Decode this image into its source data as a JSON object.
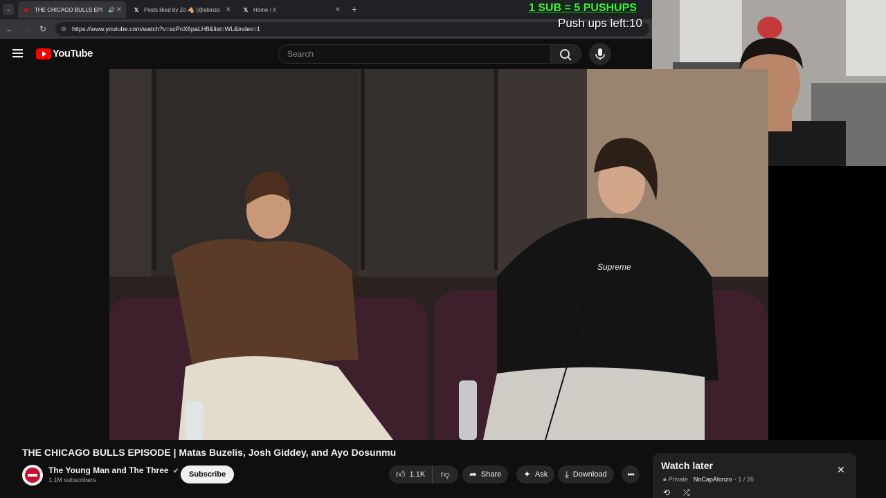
{
  "browser": {
    "tabs": [
      {
        "title": "THE CHICAGO BULLS EPISC",
        "active": true
      },
      {
        "title": "Posts liked by Zo 🐴 (@alonzo"
      },
      {
        "title": "Home / X"
      }
    ],
    "url": "https://www.youtube.com/watch?v=scPnX6paLH8&list=WL&index=1"
  },
  "stream_overlay": {
    "sub_rule": "1 SUB = 5 PUSHUPS",
    "pushups_left": "Push ups left:10"
  },
  "youtube": {
    "logo_text": "YouTube",
    "search_placeholder": "Search",
    "video_title": "THE CHICAGO BULLS EPISODE | Matas Buzelis, Josh Giddey, and Ayo Dosunmu",
    "channel_name": "The Young Man and The Three",
    "subscribers": "1.1M subscribers",
    "subscribe_label": "Subscribe",
    "likes": "1.1K",
    "share_label": "Share",
    "ask_label": "Ask",
    "download_label": "Download",
    "hoodie_text": "Supreme"
  },
  "watch_later": {
    "title": "Watch later",
    "privacy": "Private",
    "owner": "NoCapAlonzo",
    "position": "1 / 26"
  },
  "colors": {
    "overlay_green": "#2bff2b",
    "yt_red": "#ff0000",
    "background": "#0f0f0f"
  }
}
